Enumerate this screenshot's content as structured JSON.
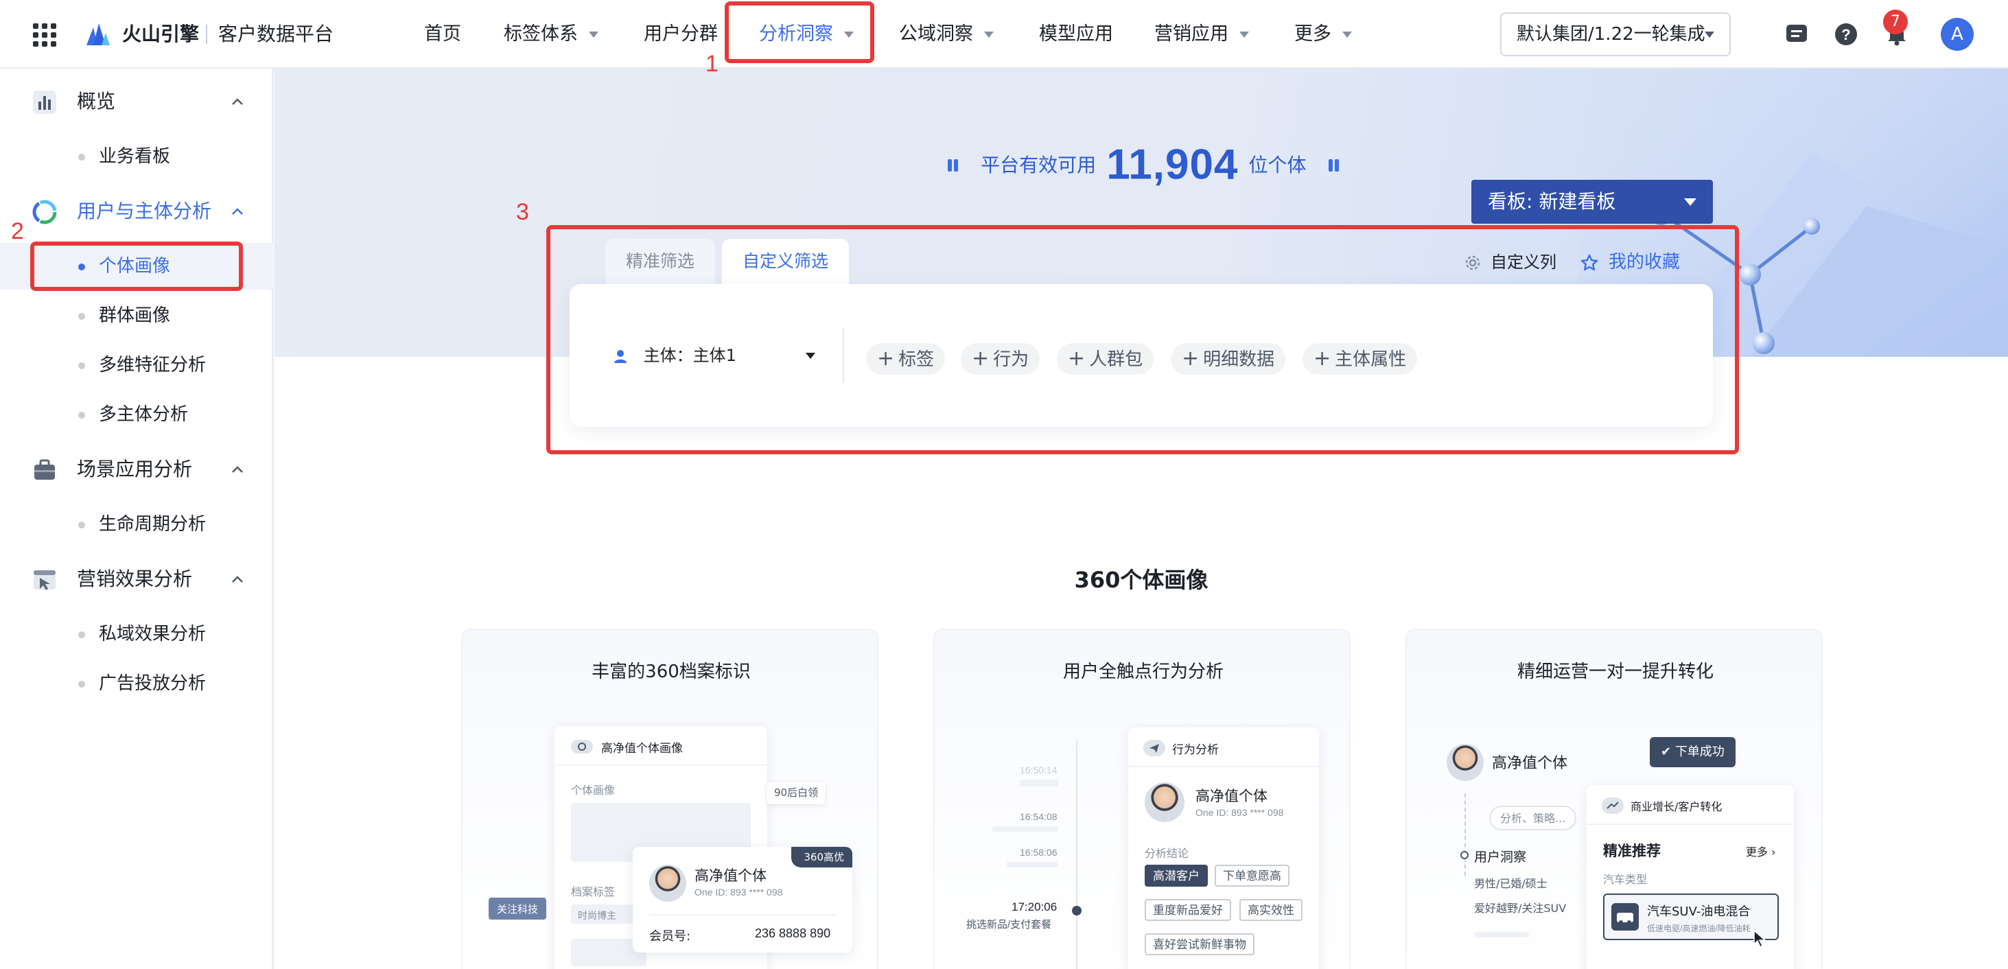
{
  "header": {
    "brand": "火山引擎",
    "product": "客户数据平台",
    "nav": [
      {
        "label": "首页",
        "dropdown": false
      },
      {
        "label": "标签体系",
        "dropdown": true
      },
      {
        "label": "用户分群",
        "dropdown": false
      },
      {
        "label": "分析洞察",
        "dropdown": true,
        "active": true
      },
      {
        "label": "公域洞察",
        "dropdown": true
      },
      {
        "label": "模型应用",
        "dropdown": false
      },
      {
        "label": "营销应用",
        "dropdown": true
      },
      {
        "label": "更多",
        "dropdown": true
      }
    ],
    "org_select": "默认集团/1.22一轮集成",
    "notification_count": "7",
    "avatar_initial": "A"
  },
  "annotations": {
    "n1": "1",
    "n2": "2",
    "n3": "3"
  },
  "sidebar": {
    "groups": [
      {
        "label": "概览",
        "icon": "bar-chart-icon",
        "items": [
          "业务看板"
        ]
      },
      {
        "label": "用户与主体分析",
        "icon": "user-analysis-icon",
        "active": true,
        "items": [
          "个体画像",
          "群体画像",
          "多维特征分析",
          "多主体分析"
        ]
      },
      {
        "label": "场景应用分析",
        "icon": "briefcase-icon",
        "items": [
          "生命周期分析"
        ]
      },
      {
        "label": "营销效果分析",
        "icon": "cursor-window-icon",
        "items": [
          "私域效果分析",
          "广告投放分析"
        ]
      }
    ],
    "active_item": "个体画像"
  },
  "hero": {
    "stat_prefix": "平台有效可用",
    "stat_value": "11,904",
    "stat_suffix": "位个体",
    "board_button": "看板: 新建看板"
  },
  "filter": {
    "tabs": [
      "精准筛选",
      "自定义筛选"
    ],
    "active_tab": "自定义筛选",
    "custom_columns": "自定义列",
    "favorites": "我的收藏",
    "subject_label": "主体：主体1",
    "add_buttons": [
      "标签",
      "行为",
      "人群包",
      "明细数据",
      "主体属性"
    ]
  },
  "showcase": {
    "title": "360个体画像",
    "cards": [
      {
        "title": "丰富的360档案标识",
        "panel_title": "高净值个体画像",
        "section_label": "个体画像",
        "tag_float": "90后白领",
        "archive_label": "档案标签",
        "archive_tag": "时尚博主",
        "side_tag": "关注科技",
        "person_name": "高净值个体",
        "person_id": "One ID: 893 **** 098",
        "corner_badge": "360高优",
        "member_label": "会员号:",
        "member_value": "236 8888 890"
      },
      {
        "title": "用户全触点行为分析",
        "timeline": [
          "16:50:14",
          "16:54:08",
          "16:58:06",
          "17:20:06"
        ],
        "timeline_note": "挑选新品/支付套餐",
        "panel_title": "行为分析",
        "person_name": "高净值个体",
        "person_id": "One ID: 893 **** 098",
        "conclusion_label": "分析结论",
        "tags": [
          "高潜客户",
          "下单意愿高",
          "重度新品爱好",
          "高实效性",
          "喜好尝试新鲜事物"
        ]
      },
      {
        "title": "精细运营一对一提升转化",
        "person_name": "高净值个体",
        "success_badge": "下单成功",
        "strategy_bubble": "分析、策略...",
        "insight_label": "用户洞察",
        "insight_lines": [
          "男性/已婚/硕士",
          "爱好越野/关注SUV"
        ],
        "panel_title": "商业增长/客户转化",
        "recommend_label": "精准推荐",
        "more_label": "更多",
        "car_type_label": "汽车类型",
        "car_title": "汽车SUV-油电混合",
        "car_desc": "低速电驱/高速燃油/降低油耗"
      }
    ]
  },
  "colors": {
    "accent": "#3b6ee6",
    "annotation": "#e63a3a",
    "board_button": "#2f4fa8"
  }
}
